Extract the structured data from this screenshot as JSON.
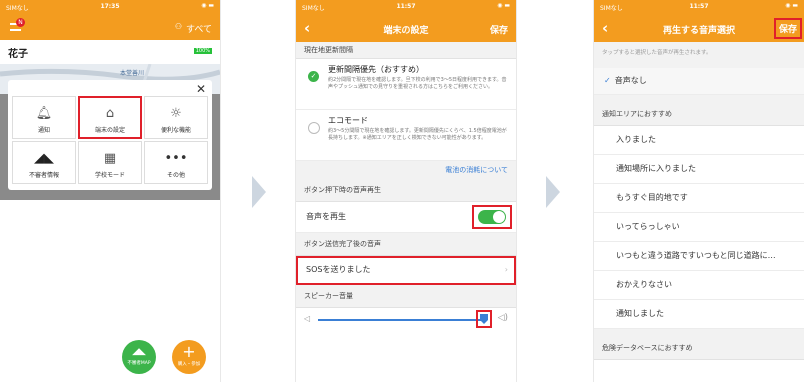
{
  "screen1": {
    "status": {
      "carrier": "SIMなし",
      "time": "17:35"
    },
    "header": {
      "badge": "N",
      "right": "すべて"
    },
    "name": "花子",
    "battery": "100%",
    "map_label": "本堂善川",
    "grid": [
      "通知",
      "端末の設定",
      "便利な機能",
      "不審者情報",
      "学校モード",
      "その他"
    ],
    "fab_left": "不審者MAP",
    "fab_right": "購入・参加"
  },
  "screen2": {
    "status": {
      "carrier": "SIMなし",
      "time": "11:57"
    },
    "title": "端末の設定",
    "save": "保存",
    "section_location": "現在地更新間隔",
    "opt1_title": "更新間隔優先（おすすめ）",
    "opt1_desc": "約2分間隔で現在地を確認します。旦下校の利用で3〜5日程度利用できます。音声やプッシュ通知での見守りを重視される方はこちらをご利用ください。",
    "opt2_title": "エコモード",
    "opt2_desc": "約3〜5分間隔で現在地を確認します。更新間隔優先にくらべ、1.5倍程度電池が長持ちします。※通知エリアを正しく検知できない可能性があります。",
    "battery_link": "電池の消耗について",
    "section_button": "ボタン押下時の音声再生",
    "play_label": "音声を再生",
    "section_after": "ボタン送信完了後の音声",
    "sos_row": "SOSを送りました",
    "section_volume": "スピーカー音量"
  },
  "screen3": {
    "status": {
      "carrier": "SIMなし",
      "time": "11:57"
    },
    "title": "再生する音声選択",
    "save": "保存",
    "hint": "タップすると選択した音声が再生されます。",
    "selected": "音声なし",
    "section1": "通知エリアにおすすめ",
    "items": [
      "入りました",
      "通知場所に入りました",
      "もうすぐ目的地です",
      "いってらっしゃい",
      "いつもと違う道路ですいつもと同じ道路に…",
      "おかえりなさい",
      "通知しました"
    ],
    "section2": "危険データベースにおすすめ"
  },
  "colors": {
    "accent": "#f39c1f",
    "highlight": "#e0202a",
    "green": "#4cd964",
    "fab_green": "#3cb44a"
  }
}
